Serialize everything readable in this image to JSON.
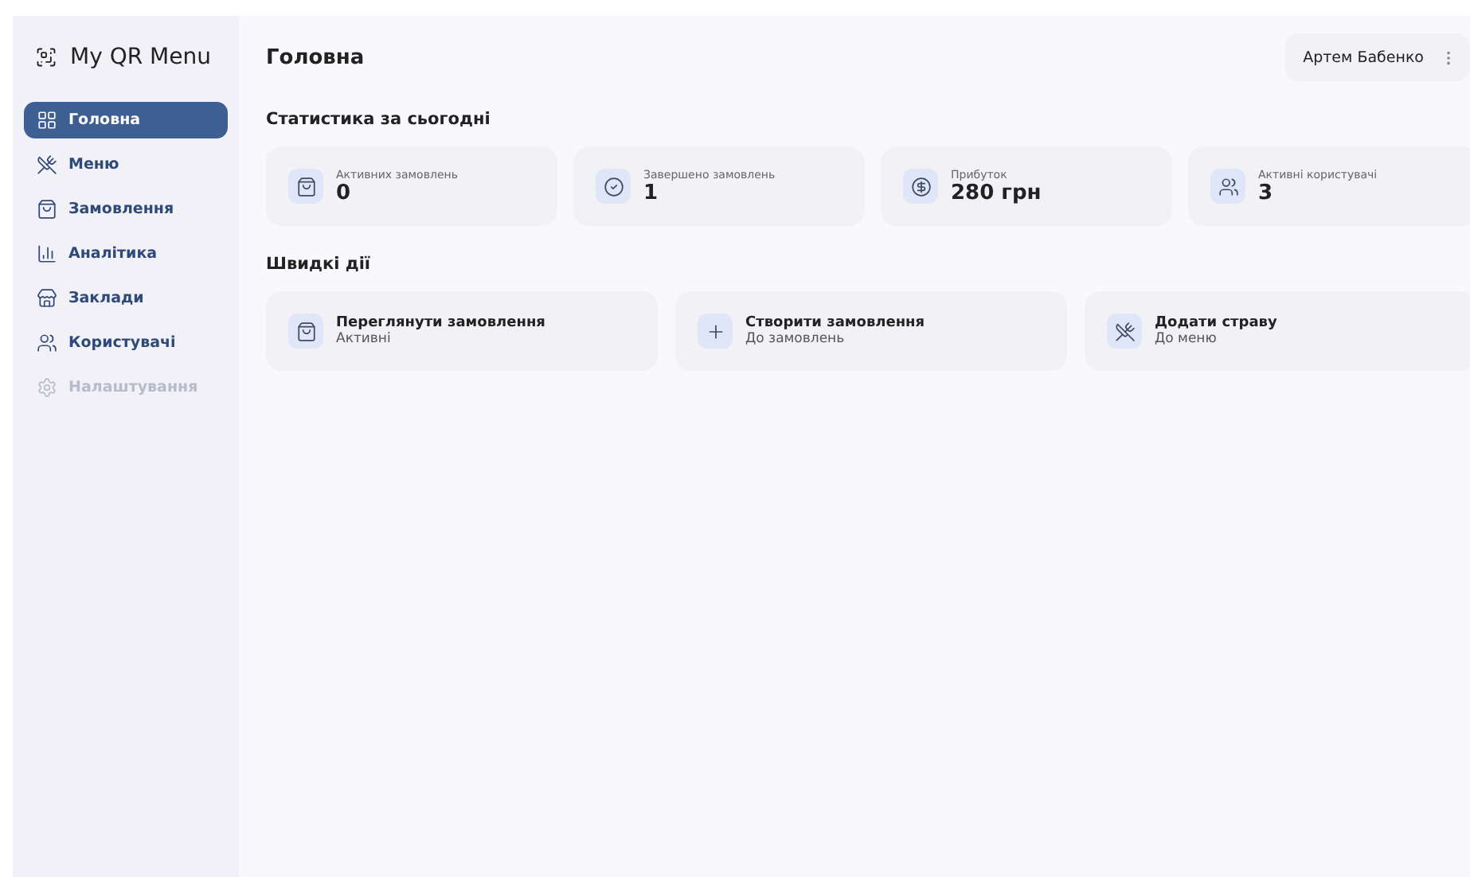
{
  "sidebar": {
    "logo": "My QR Menu",
    "items": [
      {
        "label": "Головна",
        "kind": "home",
        "selected": true,
        "disabled": false
      },
      {
        "label": "Меню",
        "kind": "menu",
        "selected": false,
        "disabled": false
      },
      {
        "label": "Замовлення",
        "kind": "orders",
        "selected": false,
        "disabled": false
      },
      {
        "label": "Аналітика",
        "kind": "analytics",
        "selected": false,
        "disabled": false
      },
      {
        "label": "Заклади",
        "kind": "places",
        "selected": false,
        "disabled": false
      },
      {
        "label": "Користувачі",
        "kind": "users",
        "selected": false,
        "disabled": false
      },
      {
        "label": "Налаштування",
        "kind": "settings",
        "selected": false,
        "disabled": true
      }
    ]
  },
  "header": {
    "title": "Головна",
    "user": "Артем Бабенко"
  },
  "stats": {
    "title": "Статистика за сьогодні",
    "cards": [
      {
        "label": "Активних замовлень",
        "value": "0",
        "kind": "orders"
      },
      {
        "label": "Завершено замовлень",
        "value": "1",
        "kind": "done"
      },
      {
        "label": "Прибуток",
        "value": "280 грн",
        "kind": "money"
      },
      {
        "label": "Активні користувачі",
        "value": "3",
        "kind": "users"
      }
    ]
  },
  "quick_actions": {
    "title": "Швидкі дії",
    "cards": [
      {
        "title": "Переглянути замовлення",
        "subtitle": "Активні",
        "kind": "orders"
      },
      {
        "title": "Створити замовлення",
        "subtitle": "До замовлень",
        "kind": "add"
      },
      {
        "title": "Додати страву",
        "subtitle": "До меню",
        "kind": "menu"
      }
    ]
  }
}
